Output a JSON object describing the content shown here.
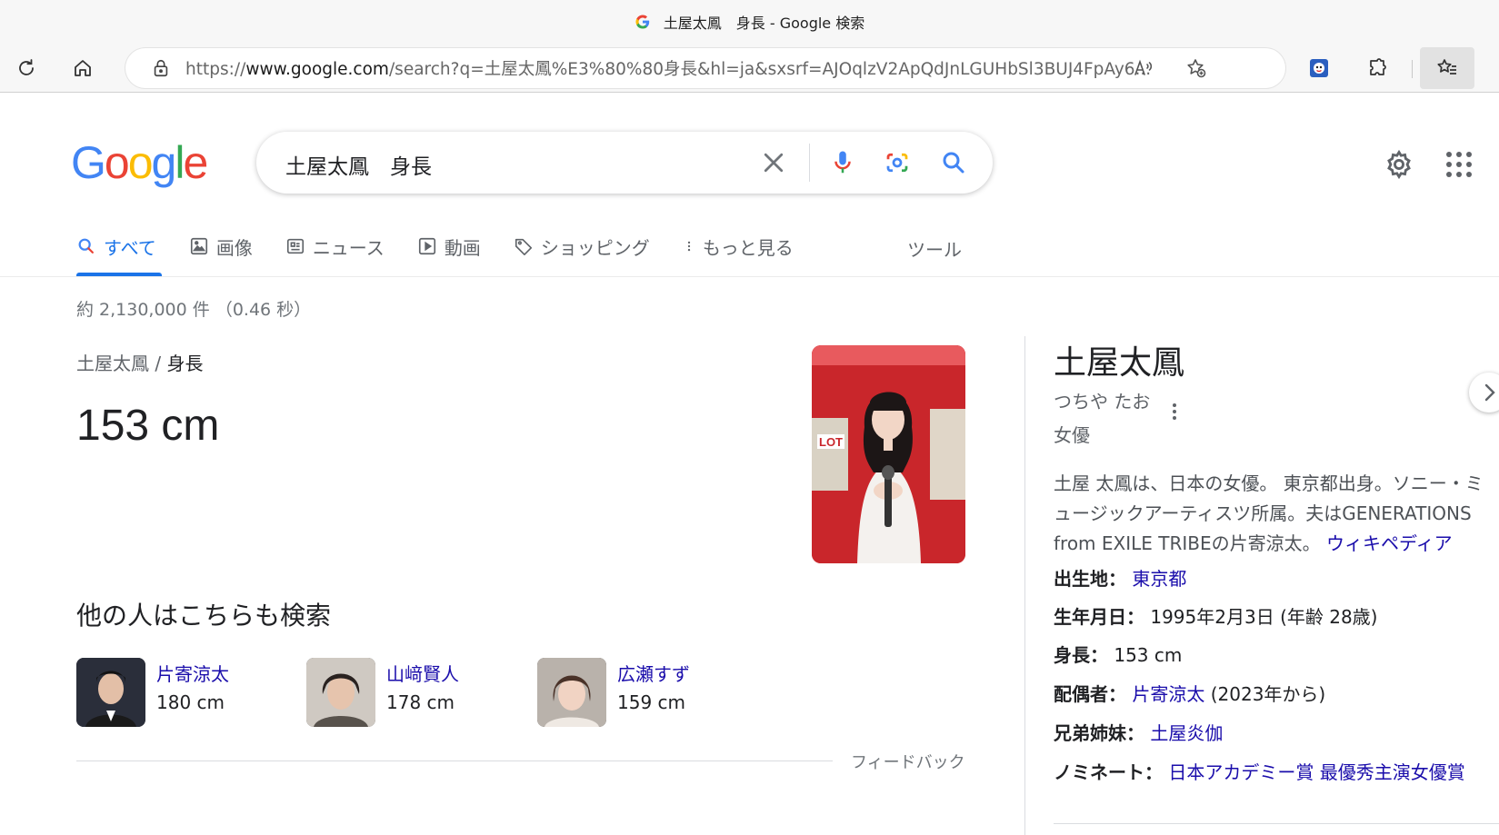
{
  "browser": {
    "tab_title": "土屋太鳳　身長 - Google 検索",
    "url_prefix": "https://",
    "url_host": "www.google.com",
    "url_rest": "/search?q=土屋太鳳%E3%80%80身長&hl=ja&sxsrf=AJOqlzV2ApQdJnLGUHbSl3BUJ4FpAy6..."
  },
  "search": {
    "query": "土屋太鳳　身長"
  },
  "tabs": [
    {
      "label": "すべて",
      "icon": "search-icon"
    },
    {
      "label": "画像",
      "icon": "image-icon"
    },
    {
      "label": "ニュース",
      "icon": "news-icon"
    },
    {
      "label": "動画",
      "icon": "video-icon"
    },
    {
      "label": "ショッピング",
      "icon": "tag-icon"
    },
    {
      "label": "もっと見る",
      "icon": "more-vert-icon"
    }
  ],
  "tools_label": "ツール",
  "result_stats": "約 2,130,000 件 （0.46 秒）",
  "answer": {
    "crumb_entity": "土屋太鳳",
    "crumb_sep": " / ",
    "crumb_attr": "身長",
    "value": "153 cm"
  },
  "people_also_search": {
    "title": "他の人はこちらも検索",
    "people": [
      {
        "name": "片寄涼太",
        "height": "180 cm"
      },
      {
        "name": "山﨑賢人",
        "height": "178 cm"
      },
      {
        "name": "広瀬すず",
        "height": "159 cm"
      }
    ],
    "feedback": "フィードバック"
  },
  "knowledge_panel": {
    "title": "土屋太鳳",
    "reading": "つちや たお",
    "subtitle": "女優",
    "desc_line1": "土屋 太鳳は、日本の女優。 東京都出身。ソニー・ミ",
    "desc_line2": "ュージックアーティスツ所属。夫はGENERATIONS",
    "desc_line3": "from EXILE TRIBEの片寄涼太。 ",
    "desc_link": "ウィキペディア",
    "facts": {
      "birthplace_label": "出生地：",
      "birthplace_value": "東京都",
      "birthdate_label": "生年月日：",
      "birthdate_value": "1995年2月3日 (年齢 28歳)",
      "height_label": "身長：",
      "height_value": "153 cm",
      "spouse_label": "配偶者：",
      "spouse_value": "片寄涼太",
      "spouse_suffix": " (2023年から)",
      "sibling_label": "兄弟姉妹：",
      "sibling_value": "土屋炎伽",
      "nominee_label": "ノミネート：",
      "nominee_value": "日本アカデミー賞 最優秀主演女優賞"
    }
  },
  "colors": {
    "google_blue": "#4285f4",
    "google_red": "#ea4335",
    "google_yellow": "#fbbc05",
    "google_green": "#34a853",
    "link": "#1a0dab",
    "tab_active": "#1a73e8"
  }
}
